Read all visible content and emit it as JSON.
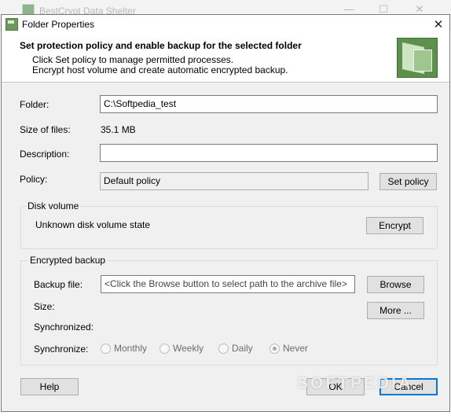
{
  "background_window": {
    "title": "BestCrypt Data Shelter"
  },
  "dialog": {
    "title": "Folder Properties",
    "close_label": "✕"
  },
  "header": {
    "title": "Set protection policy and enable backup for the selected folder",
    "line1": "Click Set policy to manage permitted processes.",
    "line2": "Encrypt host volume and create automatic encrypted backup."
  },
  "form": {
    "folder_label": "Folder:",
    "folder_value": "C:\\Softpedia_test",
    "size_label": "Size of files:",
    "size_value": "35.1 MB",
    "description_label": "Description:",
    "description_value": "",
    "policy_label": "Policy:",
    "policy_value": "Default policy",
    "set_policy_button": "Set policy"
  },
  "disk_volume": {
    "title": "Disk volume",
    "state": "Unknown disk volume state",
    "encrypt_button": "Encrypt"
  },
  "encrypted_backup": {
    "title": "Encrypted backup",
    "backup_file_label": "Backup file:",
    "backup_file_placeholder": "<Click the Browse button to select path to the archive file>",
    "browse_button": "Browse",
    "size_label": "Size:",
    "more_button": "More ...",
    "synchronized_label": "Synchronized:",
    "synchronize_label": "Synchronize:",
    "options": [
      "Monthly",
      "Weekly",
      "Daily",
      "Never"
    ],
    "selected": "Never"
  },
  "footer": {
    "help_button": "Help",
    "ok_button": "OK",
    "cancel_button": "Cancel"
  },
  "watermark": "SOFTPEDIA",
  "colors": {
    "accent": "#0078d7",
    "dialog_bg": "#f0f0f0",
    "icon_green": "#6c9a5a"
  }
}
